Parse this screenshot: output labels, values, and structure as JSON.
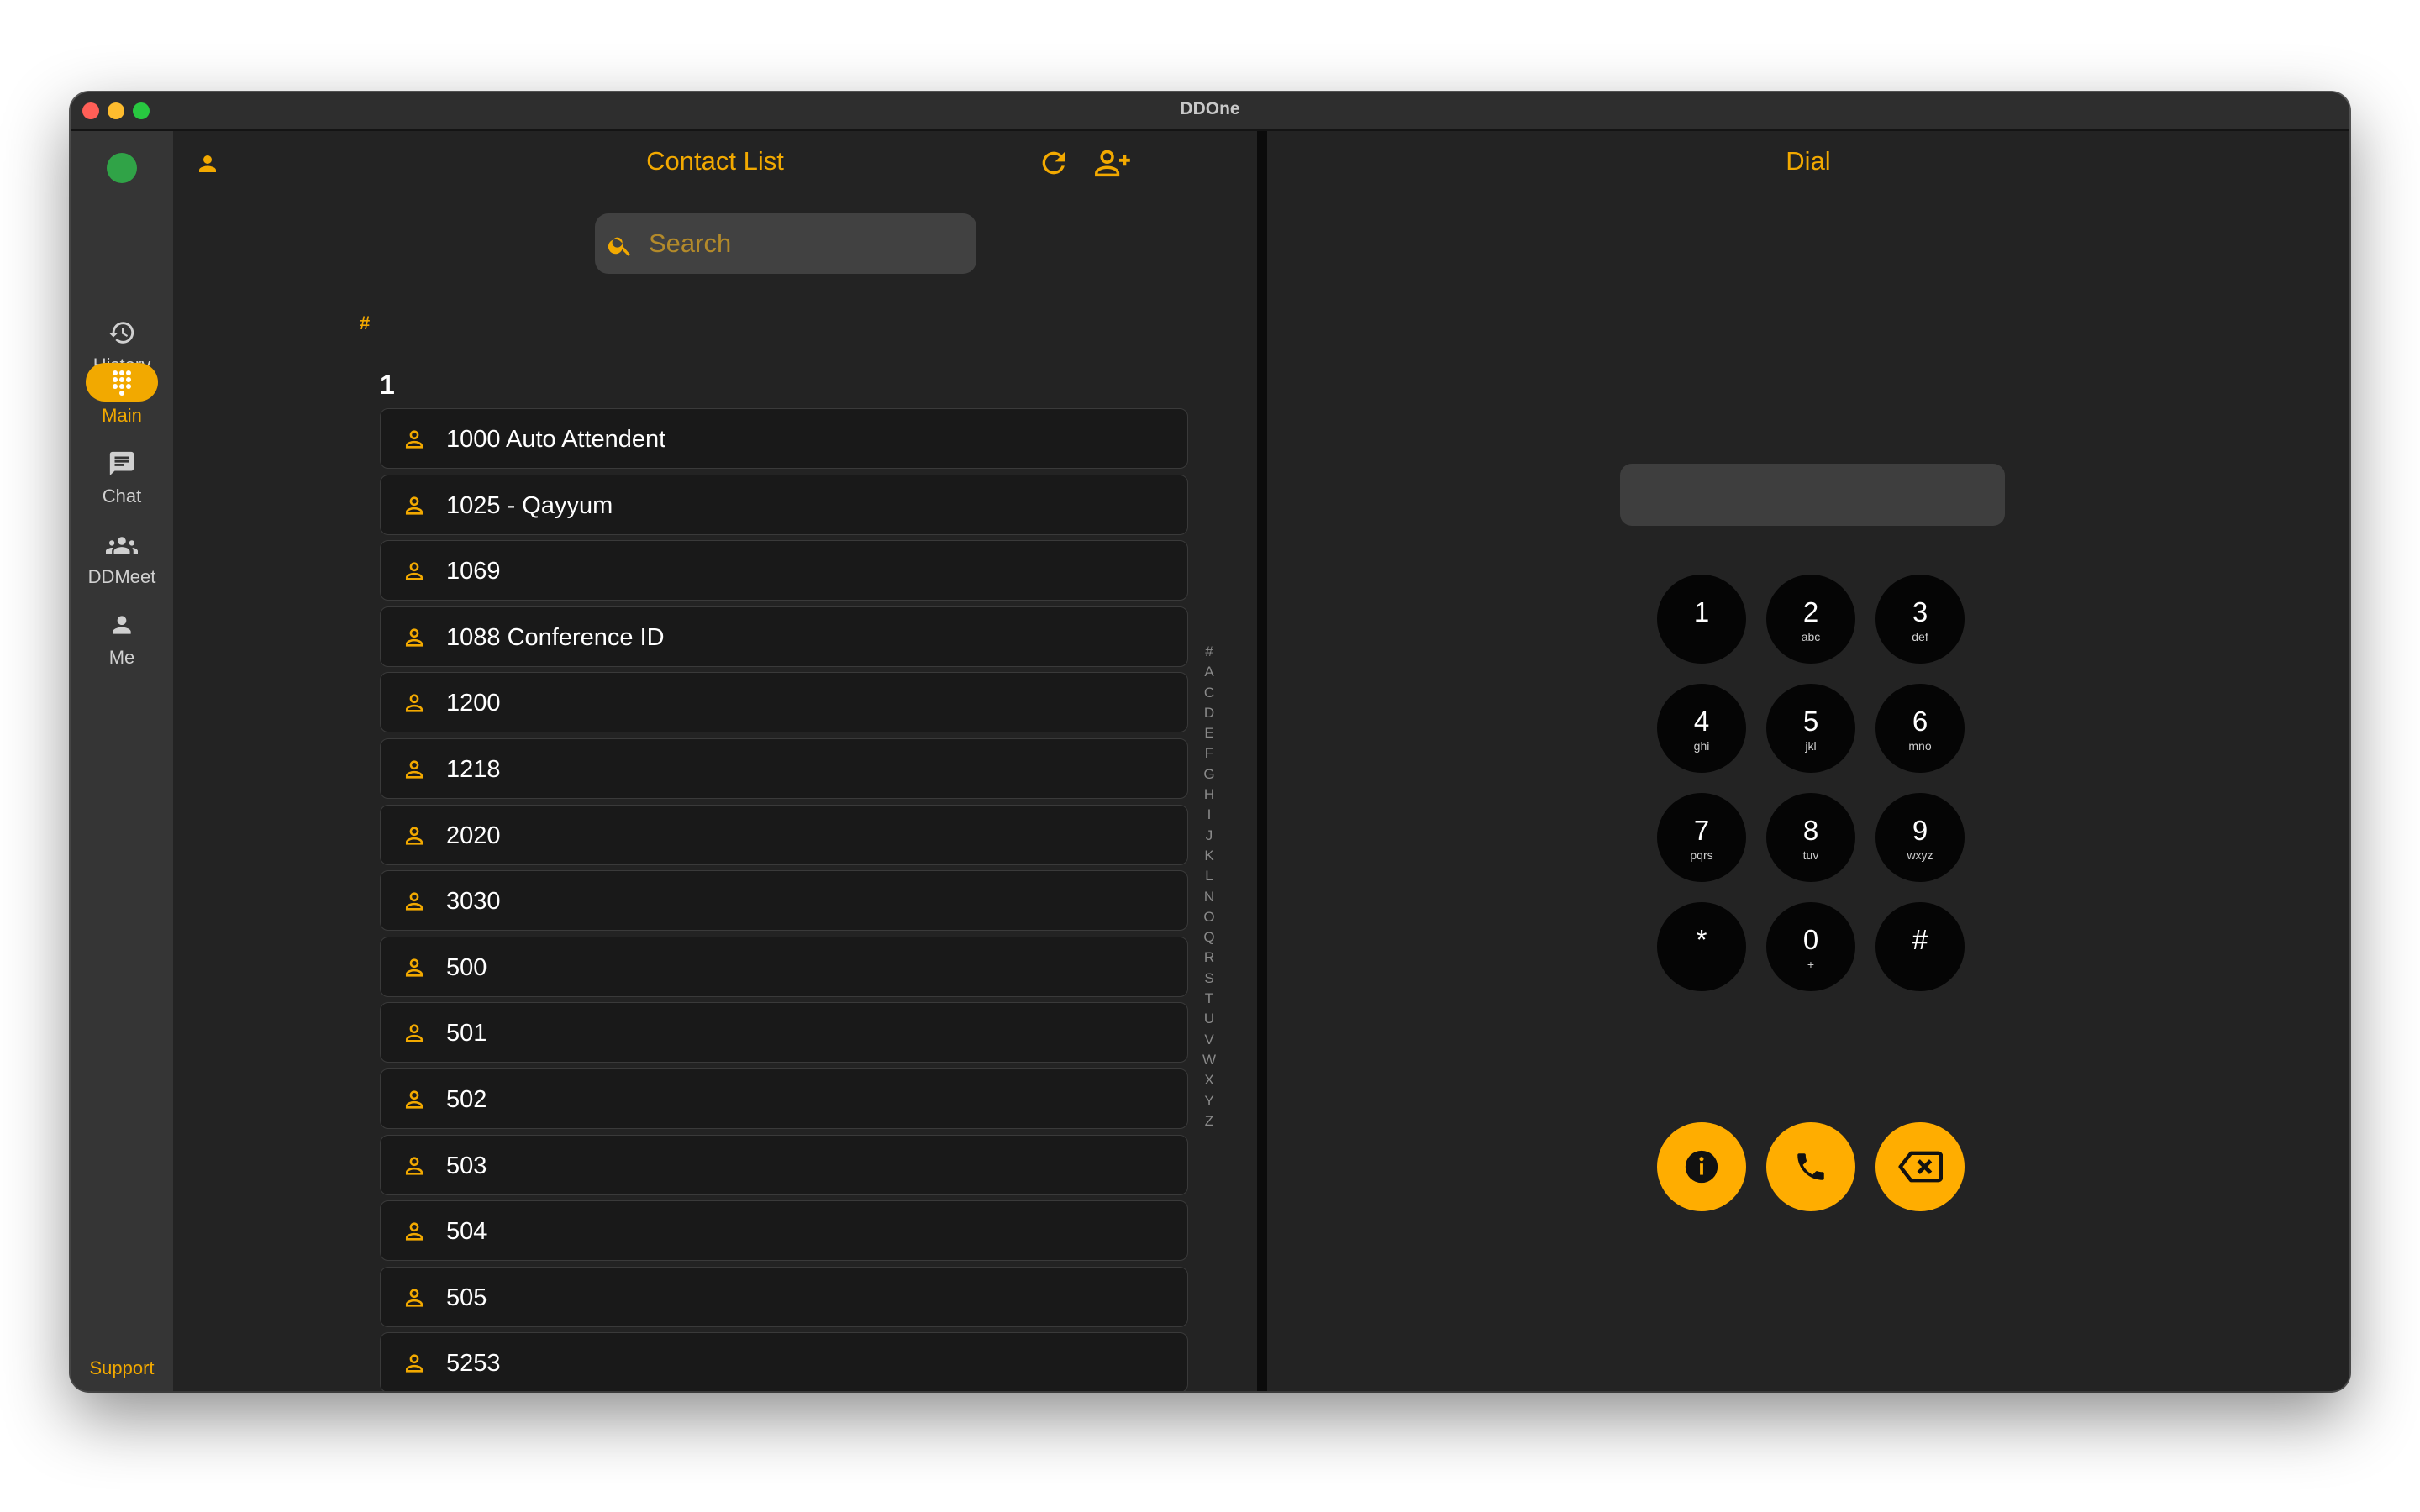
{
  "window": {
    "title": "DDOne"
  },
  "colors": {
    "accent": "#f2a900",
    "action": "#ffad00",
    "online": "#30a347"
  },
  "sidebar": {
    "status_icon": "online-status-dot",
    "items": [
      {
        "label": "History",
        "icon": "history-icon",
        "active": false
      },
      {
        "label": "Main",
        "icon": "dialpad-icon",
        "active": true
      },
      {
        "label": "Chat",
        "icon": "chat-icon",
        "active": false
      },
      {
        "label": "DDMeet",
        "icon": "group-icon",
        "active": false
      },
      {
        "label": "Me",
        "icon": "person-icon",
        "active": false
      }
    ],
    "support_label": "Support"
  },
  "contacts": {
    "title": "Contact List",
    "search_placeholder": "Search",
    "hash_marker": "#",
    "group_header": "1",
    "items": [
      "1000 Auto Attendent",
      "1025 - Qayyum",
      "1069",
      "1088 Conference ID",
      "1200",
      "1218",
      "2020",
      "3030",
      "500",
      "501",
      "502",
      "503",
      "504",
      "505",
      "5253"
    ],
    "alphabet_index": [
      "#",
      "A",
      "C",
      "D",
      "E",
      "F",
      "G",
      "H",
      "I",
      "J",
      "K",
      "L",
      "N",
      "O",
      "Q",
      "R",
      "S",
      "T",
      "U",
      "V",
      "W",
      "X",
      "Y",
      "Z"
    ]
  },
  "dial": {
    "title": "Dial",
    "number_value": "",
    "keys": [
      {
        "digit": "1",
        "letters": ""
      },
      {
        "digit": "2",
        "letters": "abc"
      },
      {
        "digit": "3",
        "letters": "def"
      },
      {
        "digit": "4",
        "letters": "ghi"
      },
      {
        "digit": "5",
        "letters": "jkl"
      },
      {
        "digit": "6",
        "letters": "mno"
      },
      {
        "digit": "7",
        "letters": "pqrs"
      },
      {
        "digit": "8",
        "letters": "tuv"
      },
      {
        "digit": "9",
        "letters": "wxyz"
      },
      {
        "digit": "*",
        "letters": ""
      },
      {
        "digit": "0",
        "letters": "+"
      },
      {
        "digit": "#",
        "letters": ""
      }
    ],
    "actions": [
      "info-icon",
      "phone-icon",
      "backspace-icon"
    ]
  }
}
